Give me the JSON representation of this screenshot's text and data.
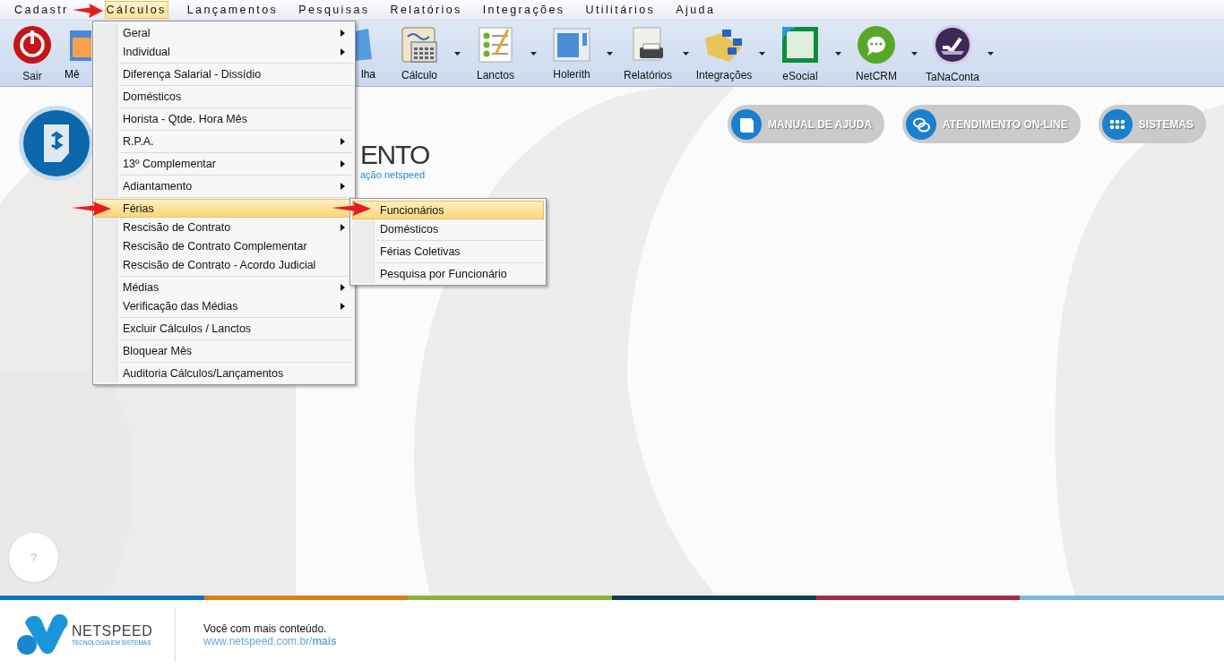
{
  "menubar": [
    {
      "label": "Cadastr",
      "selected": false
    },
    {
      "label": "Cálculos",
      "selected": true
    },
    {
      "label": "Lançamentos",
      "selected": false
    },
    {
      "label": "Pesquisas",
      "selected": false
    },
    {
      "label": "Relatórios",
      "selected": false
    },
    {
      "label": "Integrações",
      "selected": false
    },
    {
      "label": "Utilitários",
      "selected": false
    },
    {
      "label": "Ajuda",
      "selected": false
    }
  ],
  "toolbar": [
    {
      "label": "Sair",
      "kind": "button",
      "dropdown": false
    },
    {
      "label": "Mê",
      "kind": "clipped"
    },
    {
      "label": "lha",
      "kind": "clipped"
    },
    {
      "label": "Cálculo",
      "kind": "button",
      "dropdown": true
    },
    {
      "label": "Lanctos",
      "kind": "button",
      "dropdown": true
    },
    {
      "label": "Holerith",
      "kind": "button",
      "dropdown": true
    },
    {
      "label": "Relatórios",
      "kind": "button",
      "dropdown": true
    },
    {
      "label": "Integrações",
      "kind": "button",
      "dropdown": true
    },
    {
      "label": "eSocial",
      "kind": "button",
      "dropdown": true
    },
    {
      "label": "NetCRM",
      "kind": "button",
      "dropdown": true
    },
    {
      "label": "TaNaConta",
      "kind": "button",
      "dropdown": true
    }
  ],
  "menu": {
    "groups": [
      [
        {
          "label": "Geral",
          "submenu": true,
          "selected": false
        },
        {
          "label": "Individual",
          "submenu": true,
          "selected": false
        }
      ],
      [
        {
          "label": "Diferença Salarial - Dissídio",
          "submenu": false,
          "selected": false
        }
      ],
      [
        {
          "label": "Domésticos",
          "submenu": false,
          "selected": false
        }
      ],
      [
        {
          "label": "Horista - Qtde. Hora Mês",
          "submenu": false,
          "selected": false
        }
      ],
      [
        {
          "label": "R.P.A.",
          "submenu": true,
          "selected": false
        }
      ],
      [
        {
          "label": "13º Complementar",
          "submenu": true,
          "selected": false
        }
      ],
      [
        {
          "label": "Adiantamento",
          "submenu": true,
          "selected": false
        }
      ],
      [
        {
          "label": "Férias",
          "submenu": false,
          "selected": true
        },
        {
          "label": "Rescisão de Contrato",
          "submenu": true,
          "selected": false
        },
        {
          "label": "Rescisão de Contrato Complementar",
          "submenu": false,
          "selected": false
        },
        {
          "label": "Rescisão de Contrato - Acordo Judicial",
          "submenu": false,
          "selected": false
        }
      ],
      [
        {
          "label": "Médias",
          "submenu": true,
          "selected": false
        },
        {
          "label": "Verificação das Médias",
          "submenu": true,
          "selected": false
        }
      ],
      [
        {
          "label": "Excluir Cálculos / Lanctos",
          "submenu": false,
          "selected": false
        }
      ],
      [
        {
          "label": "Bloquear Mês",
          "submenu": false,
          "selected": false
        }
      ],
      [
        {
          "label": "Auditoria Cálculos/Lançamentos",
          "submenu": false,
          "selected": false
        }
      ]
    ]
  },
  "submenu": {
    "groups": [
      [
        {
          "label": "Funcionários",
          "selected": true
        },
        {
          "label": "Domésticos",
          "selected": false
        }
      ],
      [
        {
          "label": "Férias Coletivas",
          "selected": false
        }
      ],
      [
        {
          "label": "Pesquisa por Funcionário",
          "selected": false
        }
      ]
    ]
  },
  "header": {
    "title": "ENTO",
    "subtitle": "ação netspeed"
  },
  "actions": [
    {
      "label": "MANUAL DE AJUDA"
    },
    {
      "label": "ATENDIMENTO ON-LINE"
    },
    {
      "label": "SISTEMAS"
    }
  ],
  "help_button": "?",
  "footer": {
    "brand": "NETSPEED",
    "tagline": "TECNOLOGIA EM SISTEMAS",
    "message": "Você com mais conteúdo.",
    "link": "www.netspeed.com.br/**mais**"
  }
}
